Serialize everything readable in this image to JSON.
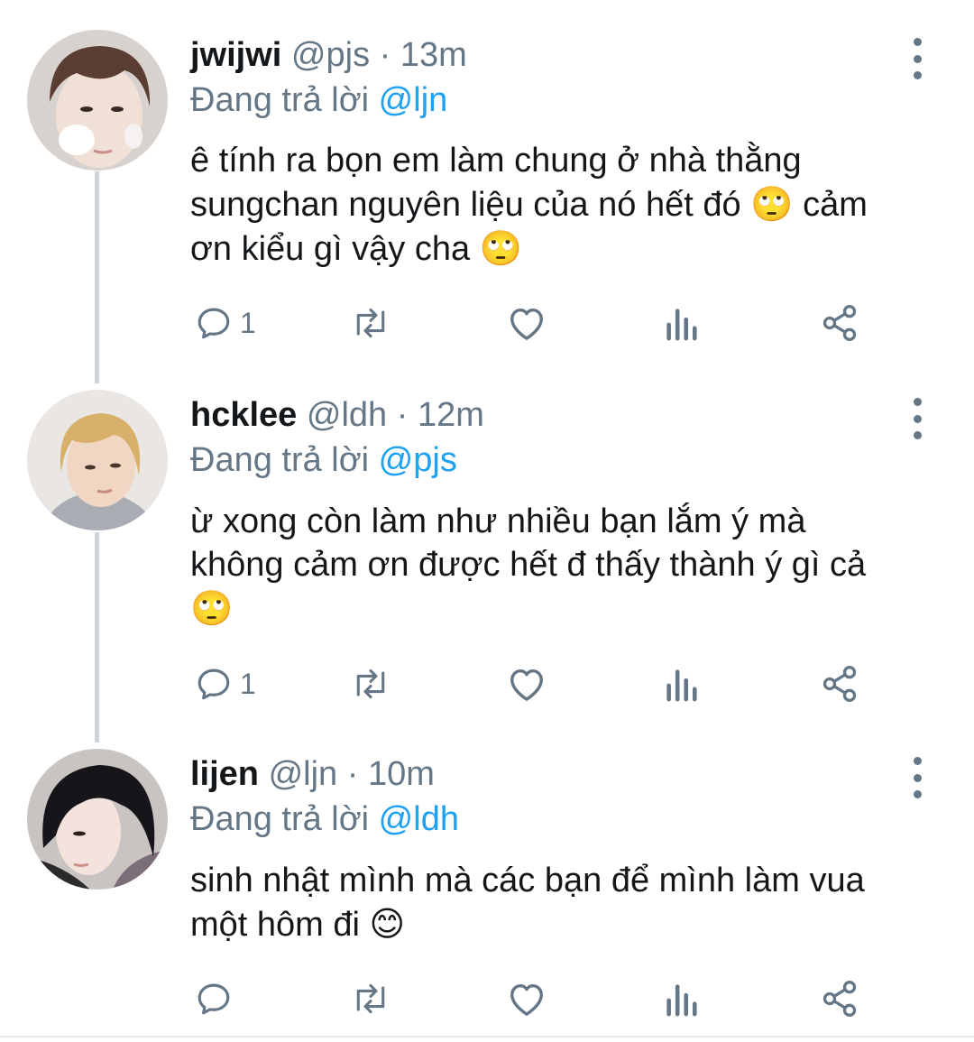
{
  "tweets": [
    {
      "name": "jwijwi",
      "handle": "@pjs",
      "separator": "·",
      "time": "13m",
      "reply_prefix": "Đang trả lời",
      "reply_to": "@ljn",
      "text_lines": [
        "ê tính ra bọn em làm chung ở nhà thằng",
        "sungchan nguyên liệu của nó hết đó",
        "cảm",
        "ơn kiểu gì vậy cha"
      ],
      "emoji_1": "🙄",
      "emoji_2": "🙄",
      "reply_count": "1",
      "avatar_icon": "profile-photo-light-hair"
    },
    {
      "name": "hcklee",
      "handle": "@ldh",
      "separator": "·",
      "time": "12m",
      "reply_prefix": "Đang trả lời",
      "reply_to": "@pjs",
      "text_lines": [
        "ừ xong còn làm như nhiều bạn lắm ý mà",
        "không cảm ơn được hết đ thấy thành ý gì cả"
      ],
      "emoji_1": "🙄",
      "reply_count": "1",
      "avatar_icon": "profile-photo-blond-hair"
    },
    {
      "name": "lijen",
      "handle": "@ljn",
      "separator": "·",
      "time": "10m",
      "reply_prefix": "Đang trả lời",
      "reply_to": "@ldh",
      "text_lines": [
        "sinh nhật mình mà các bạn để mình làm vua",
        "một hôm đi"
      ],
      "emoji_1": "😊",
      "reply_count": "",
      "avatar_icon": "profile-photo-dark-hair"
    }
  ],
  "icons": {
    "reply": "speech-bubble-icon",
    "retweet": "retweet-arrows-icon",
    "like": "heart-icon",
    "analytics": "bar-chart-icon",
    "share": "share-nodes-icon",
    "more": "vertical-ellipsis-icon"
  },
  "colors": {
    "text": "#14171a",
    "secondary": "#657786",
    "mention": "#1da1f2",
    "thread_line": "#cdd4da"
  }
}
